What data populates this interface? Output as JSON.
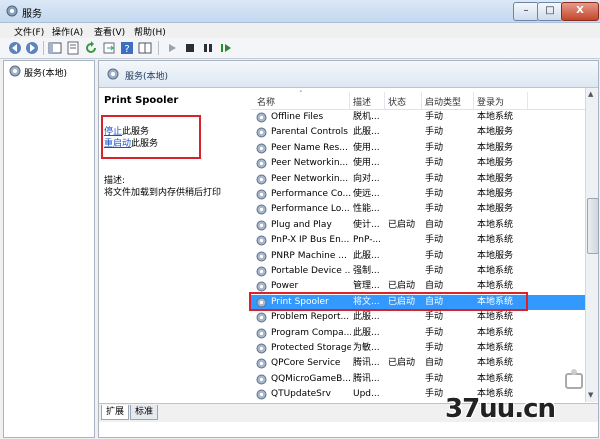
{
  "window": {
    "title": "服务",
    "min": "–",
    "max": "□",
    "close": "X"
  },
  "menu": [
    "文件(F)",
    "操作(A)",
    "查看(V)",
    "帮助(H)"
  ],
  "tree": {
    "root_label": "服务(本地)"
  },
  "pane": {
    "header_title": "服务(本地)",
    "selected_service": "Print Spooler",
    "actions": [
      {
        "link": "停止",
        "suffix": "此服务"
      },
      {
        "link": "重启动",
        "suffix": "此服务"
      }
    ],
    "desc_label": "描述:",
    "desc_text": "将文件加载到内存供稍后打印"
  },
  "table": {
    "columns": [
      "名称",
      "描述",
      "状态",
      "启动类型",
      "登录为"
    ],
    "rows": [
      [
        "Offline Files",
        "脱机...",
        "",
        "手动",
        "本地系统"
      ],
      [
        "Parental Controls",
        "此服...",
        "",
        "手动",
        "本地服务"
      ],
      [
        "Peer Name Res...",
        "使用...",
        "",
        "手动",
        "本地服务"
      ],
      [
        "Peer Networkin...",
        "使用...",
        "",
        "手动",
        "本地服务"
      ],
      [
        "Peer Networkin...",
        "向对...",
        "",
        "手动",
        "本地服务"
      ],
      [
        "Performance Co...",
        "使远...",
        "",
        "手动",
        "本地服务"
      ],
      [
        "Performance Lo...",
        "性能...",
        "",
        "手动",
        "本地服务"
      ],
      [
        "Plug and Play",
        "使计...",
        "已启动",
        "自动",
        "本地系统"
      ],
      [
        "PnP-X IP Bus En...",
        "PnP-...",
        "",
        "手动",
        "本地系统"
      ],
      [
        "PNRP Machine ...",
        "此服...",
        "",
        "手动",
        "本地服务"
      ],
      [
        "Portable Device ...",
        "强制...",
        "",
        "手动",
        "本地系统"
      ],
      [
        "Power",
        "管理...",
        "已启动",
        "自动",
        "本地系统"
      ],
      [
        "Print Spooler",
        "将文...",
        "已启动",
        "自动",
        "本地系统"
      ],
      [
        "Problem Report...",
        "此服...",
        "",
        "手动",
        "本地系统"
      ],
      [
        "Program Compa...",
        "此服...",
        "",
        "手动",
        "本地系统"
      ],
      [
        "Protected Storage",
        "为敏...",
        "",
        "手动",
        "本地系统"
      ],
      [
        "QPCore Service",
        "腾讯...",
        "已启动",
        "自动",
        "本地系统"
      ],
      [
        "QQMicroGameB...",
        "腾讯...",
        "",
        "手动",
        "本地系统"
      ],
      [
        "QTUpdateSrv",
        "Upd...",
        "",
        "手动",
        "本地系统"
      ]
    ],
    "selected_index": 12
  },
  "tabs": [
    "扩展",
    "标准"
  ],
  "watermark": "37uu.cn",
  "colors": {
    "selection": "#3399ff",
    "highlight_box": "#d9232c",
    "link": "#1a4fc6"
  }
}
